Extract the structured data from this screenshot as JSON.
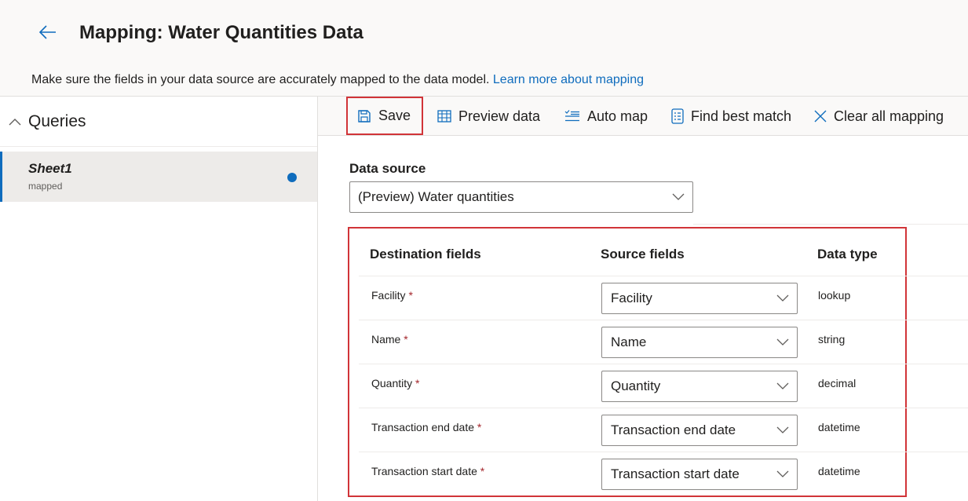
{
  "header": {
    "title": "Mapping: Water Quantities Data",
    "subtitle": "Make sure the fields in your data source are accurately mapped to the data model.",
    "learn_more": "Learn more about mapping"
  },
  "left_pane": {
    "queries_label": "Queries",
    "items": [
      {
        "name": "Sheet1",
        "status": "mapped"
      }
    ]
  },
  "toolbar": {
    "save": "Save",
    "preview": "Preview data",
    "automap": "Auto map",
    "bestmatch": "Find best match",
    "clear": "Clear all mapping"
  },
  "data_source": {
    "label": "Data source",
    "value": "(Preview) Water quantities"
  },
  "mapping": {
    "headers": {
      "destination": "Destination fields",
      "source": "Source fields",
      "type": "Data type"
    },
    "required_mark": "*",
    "rows": [
      {
        "destination": "Facility",
        "source": "Facility",
        "type": "lookup"
      },
      {
        "destination": "Name",
        "source": "Name",
        "type": "string"
      },
      {
        "destination": "Quantity",
        "source": "Quantity",
        "type": "decimal"
      },
      {
        "destination": "Transaction end date",
        "source": "Transaction end date",
        "type": "datetime"
      },
      {
        "destination": "Transaction start date",
        "source": "Transaction start date",
        "type": "datetime"
      }
    ]
  },
  "colors": {
    "accent": "#0f6cbd",
    "highlight": "#d13438",
    "required": "#a4262c"
  }
}
